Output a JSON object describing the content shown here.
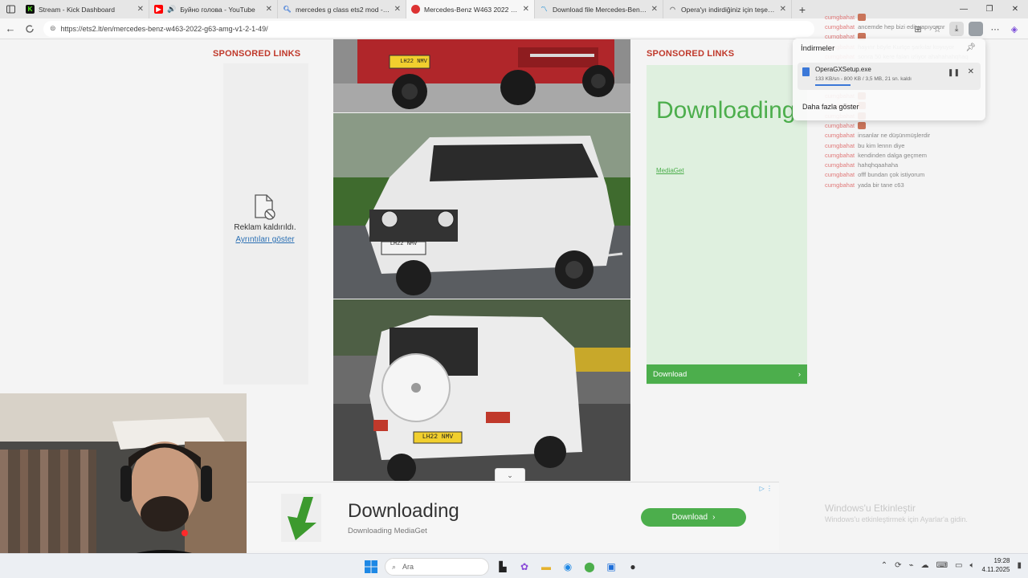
{
  "tabs": [
    {
      "title": "Stream - Kick Dashboard",
      "icon": "kick-icon",
      "color": "#53fc18",
      "active": false
    },
    {
      "title": "Буйно голова - YouTube",
      "icon": "youtube-icon",
      "color": "#ff0000",
      "active": false
    },
    {
      "title": "mercedes g class ets2 mod - Ara...",
      "icon": "search-icon",
      "color": "#3b78d8",
      "active": false
    },
    {
      "title": "Mercedes-Benz W463 2022 G63...",
      "icon": "site-icon",
      "color": "#d33",
      "active": true
    },
    {
      "title": "Download file Mercedes-Benz W...",
      "icon": "mediaget-icon",
      "color": "#4cae4c",
      "active": false
    },
    {
      "title": "Opera'yı indirdiğiniz için teşekkü...",
      "icon": "opera-loading-icon",
      "color": "#777",
      "active": false
    }
  ],
  "address_bar": {
    "url": "https://ets2.lt/en/mercedes-benz-w463-2022-g63-amg-v1-2-1-49/"
  },
  "page": {
    "sponsored_left": "SPONSORED LINKS",
    "sponsored_right": "SPONSORED LINKS",
    "removed_text": "Reklam kaldırıldı.",
    "removed_link": "Ayrıntıları göster",
    "ad_right_title": "Downloading",
    "ad_right_link": "MediaGet",
    "ad_right_button": "Download",
    "plate": "LH22 NMV"
  },
  "downloads_popup": {
    "header": "İndirmeler",
    "file_name": "OperaGXSetup.exe",
    "status": "133 KB/sn - 800 KB / 3,5 MB, 21 sn. kaldı",
    "progress_fraction": 0.22,
    "more": "Daha fazla göster"
  },
  "chat": [
    {
      "user": "cumgbahat",
      "msg": ""
    },
    {
      "user": "cumgbahat",
      "msg": "ancemde hep bizi edit yapıyormr"
    },
    {
      "user": "cumgbahat",
      "msg": ""
    },
    {
      "user": "cumgbahat",
      "msg": "hayırır böyle Kurtçe şarkılar koyuyor"
    },
    {
      "user": "cumgbahat",
      "msg": "sonra 50 kere falan izliyor ahahahahqhaq"
    },
    {
      "user": "cumgbahat",
      "msg": "yeni çek o zaman sende"
    },
    {
      "user": "cumgbahat",
      "msg": ""
    },
    {
      "user": "cumgbahat",
      "msg": ""
    },
    {
      "user": "cumgbahat",
      "msg": ""
    },
    {
      "user": "cumgbahat",
      "msg": ""
    },
    {
      "user": "cumgbahat",
      "msg": ""
    },
    {
      "user": "cumgbahat",
      "msg": ""
    },
    {
      "user": "cumgbahat",
      "msg": "insanlar ne düşünmüşlerdir"
    },
    {
      "user": "cumgbahat",
      "msg": "bu kim lennn diye"
    },
    {
      "user": "cumgbahat",
      "msg": "kendinden dalga geçmem"
    },
    {
      "user": "cumgbahat",
      "msg": "hahqhqaahaha"
    },
    {
      "user": "cumgbahat",
      "msg": "offf bundan çok istiyorum"
    },
    {
      "user": "cumgbahat",
      "msg": "yada bir tane c63"
    }
  ],
  "windows_activation": {
    "title": "Windows'u Etkinleştir",
    "subtitle": "Windows'u etkinleştirmek için Ayarlar'a gidin."
  },
  "banner": {
    "title": "Downloading",
    "subtitle": "Downloading MediaGet",
    "button": "Download"
  },
  "taskbar": {
    "search_placeholder": "Ara",
    "time": "19:28",
    "date": "4.11.2025"
  }
}
